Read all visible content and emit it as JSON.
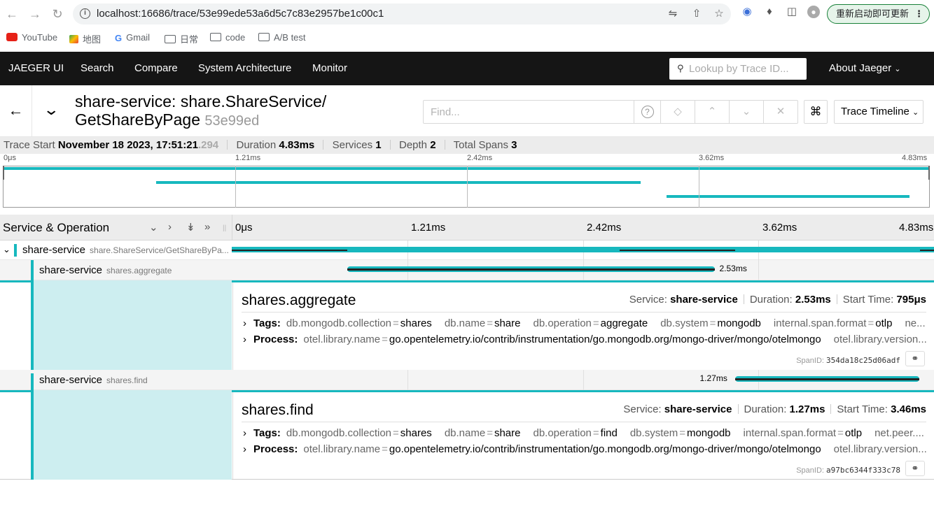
{
  "browser": {
    "url": "localhost:16686/trace/53e99ede53a6d5c7c83e2957be1c00c1",
    "update_label": "重新启动即可更新",
    "bookmarks": [
      {
        "label": "YouTube",
        "icon": "youtube-icon"
      },
      {
        "label": "地图",
        "icon": "maps-icon"
      },
      {
        "label": "Gmail",
        "icon": "google-icon"
      },
      {
        "label": "日常",
        "icon": "folder-icon"
      },
      {
        "label": "code",
        "icon": "folder-icon"
      },
      {
        "label": "A/B test",
        "icon": "folder-icon"
      }
    ]
  },
  "nav": {
    "brand": "JAEGER UI",
    "items": [
      "Search",
      "Compare",
      "System Architecture",
      "Monitor"
    ],
    "lookup_placeholder": "Lookup by Trace ID...",
    "about": "About Jaeger"
  },
  "trace": {
    "title_line1": "share-service: share.ShareService/",
    "title_line2": "GetShareByPage",
    "trace_id_short": "53e99ed",
    "find_placeholder": "Find...",
    "view_select": "Trace Timeline",
    "summary": {
      "start_label": "Trace Start",
      "start_value": "November 18 2023, 17:51:21",
      "start_ms": ".294",
      "duration_label": "Duration",
      "duration_value": "4.83ms",
      "services_label": "Services",
      "services_value": "1",
      "depth_label": "Depth",
      "depth_value": "2",
      "spans_label": "Total Spans",
      "spans_value": "3"
    },
    "ticks": [
      "0μs",
      "1.21ms",
      "2.42ms",
      "3.62ms",
      "4.83ms"
    ],
    "column_label": "Service & Operation",
    "accent": "#17b8be"
  },
  "spans": [
    {
      "service": "share-service",
      "operation": "share.ShareService/GetShareByPa...",
      "start_ms": 0,
      "duration_ms": 4.83,
      "duration_label": ""
    },
    {
      "service": "share-service",
      "operation": "shares.aggregate",
      "start_ms": 0.795,
      "duration_ms": 2.53,
      "duration_label": "2.53ms"
    },
    {
      "service": "share-service",
      "operation": "shares.find",
      "start_ms": 3.46,
      "duration_ms": 1.27,
      "duration_label": "1.27ms"
    }
  ],
  "details": [
    {
      "title": "shares.aggregate",
      "service_label": "Service:",
      "service": "share-service",
      "duration_label": "Duration:",
      "duration": "2.53ms",
      "start_label": "Start Time:",
      "start": "795μs",
      "tags_label": "Tags:",
      "tags": [
        {
          "k": "db.mongodb.collection",
          "v": "shares"
        },
        {
          "k": "db.name",
          "v": "share"
        },
        {
          "k": "db.operation",
          "v": "aggregate"
        },
        {
          "k": "db.system",
          "v": "mongodb"
        },
        {
          "k": "internal.span.format",
          "v": "otlp"
        },
        {
          "k": "ne...",
          "v": ""
        }
      ],
      "process_label": "Process:",
      "process": [
        {
          "k": "otel.library.name",
          "v": "go.opentelemetry.io/contrib/instrumentation/go.mongodb.org/mongo-driver/mongo/otelmongo"
        },
        {
          "k": "otel.library.version...",
          "v": ""
        }
      ],
      "spanid_label": "SpanID:",
      "spanid": "354da18c25d06adf"
    },
    {
      "title": "shares.find",
      "service_label": "Service:",
      "service": "share-service",
      "duration_label": "Duration:",
      "duration": "1.27ms",
      "start_label": "Start Time:",
      "start": "3.46ms",
      "tags_label": "Tags:",
      "tags": [
        {
          "k": "db.mongodb.collection",
          "v": "shares"
        },
        {
          "k": "db.name",
          "v": "share"
        },
        {
          "k": "db.operation",
          "v": "find"
        },
        {
          "k": "db.system",
          "v": "mongodb"
        },
        {
          "k": "internal.span.format",
          "v": "otlp"
        },
        {
          "k": "net.peer....",
          "v": ""
        }
      ],
      "process_label": "Process:",
      "process": [
        {
          "k": "otel.library.name",
          "v": "go.opentelemetry.io/contrib/instrumentation/go.mongodb.org/mongo-driver/mongo/otelmongo"
        },
        {
          "k": "otel.library.version...",
          "v": ""
        }
      ],
      "spanid_label": "SpanID:",
      "spanid": "a97bc6344f333c78"
    }
  ]
}
